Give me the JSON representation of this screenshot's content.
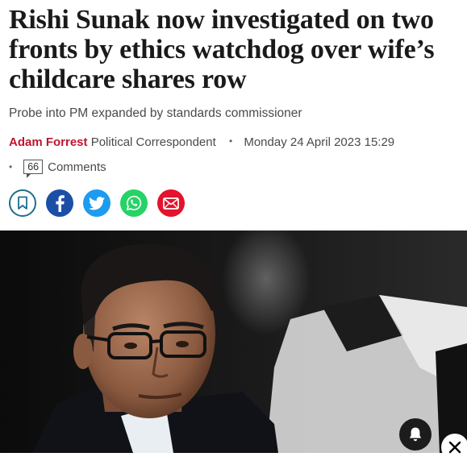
{
  "article": {
    "headline": "Rishi Sunak now investigated on two fronts by ethics watchdog over wife’s childcare shares row",
    "standfirst": "Probe into PM expanded by standards commissioner",
    "author": "Adam Forrest",
    "role": "Political Correspondent",
    "bullet": "•",
    "timestamp": "Monday 24 April 2023 15:29",
    "comment_count": "66",
    "comments_label": "Comments"
  },
  "share": {
    "icons": [
      "bookmark-icon",
      "facebook-icon",
      "twitter-icon",
      "whatsapp-icon",
      "email-icon"
    ]
  },
  "colors": {
    "author": "#c0142e",
    "bookmark_border": "#1f6f8b",
    "facebook": "#1b4fa6",
    "twitter": "#1d9bf0",
    "whatsapp": "#25d366",
    "email": "#e4122d"
  },
  "overlays": {
    "notification_icon": "bell-icon",
    "close_icon": "close-icon"
  }
}
